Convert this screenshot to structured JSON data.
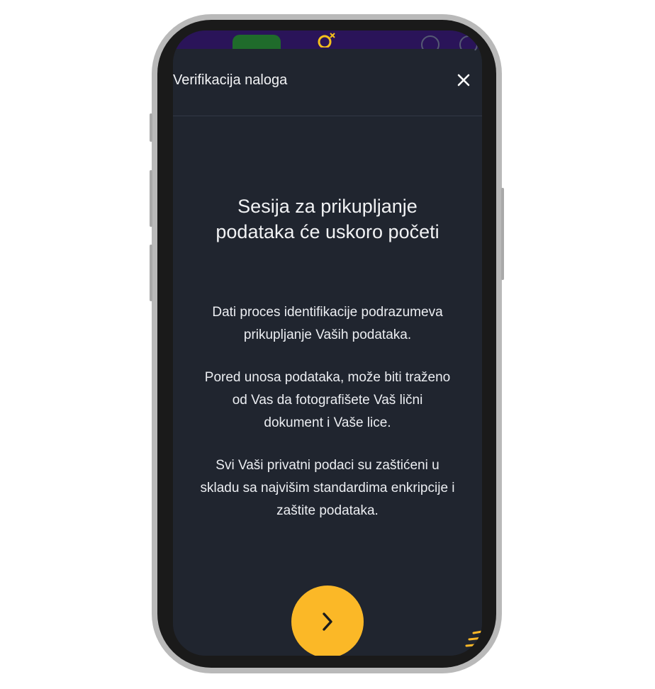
{
  "modal": {
    "title": "Verifikacija naloga",
    "headline_line1": "Sesija za prikupljanje",
    "headline_line2": "podataka će uskoro početi",
    "paragraphs": [
      [
        "Dati proces identifikacije podrazumeva",
        "prikupljanje Vaših podataka."
      ],
      [
        "Pored unosa podataka, može biti traženo",
        "od Vas da fotografišete Vaš lični",
        "dokument i Vaše lice."
      ],
      [
        "Svi Vaši privatni podaci su zaštićeni u",
        "skladu sa najvišim standardima enkripcije i",
        "zaštite podataka."
      ]
    ]
  },
  "icons": {
    "close": "close-icon",
    "next": "chevron-right-icon",
    "corner": "menu-lines-icon"
  },
  "colors": {
    "background": "#20252f",
    "accent": "#fbb827",
    "topbar": "#2a1459",
    "text": "#f2f3f5"
  }
}
